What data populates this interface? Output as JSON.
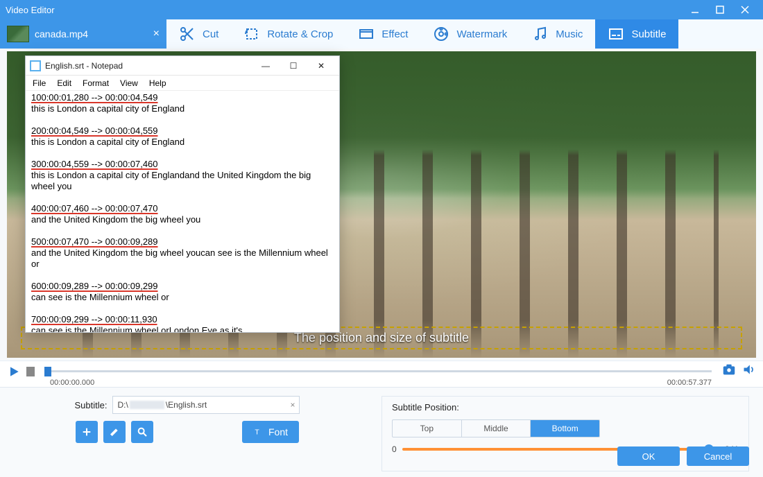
{
  "window": {
    "title": "Video Editor"
  },
  "file_tab": {
    "name": "canada.mp4"
  },
  "tabs": {
    "cut": "Cut",
    "rotate": "Rotate & Crop",
    "effect": "Effect",
    "watermark": "Watermark",
    "music": "Music",
    "subtitle": "Subtitle",
    "active": "subtitle"
  },
  "preview": {
    "overlay_text": "The position and size of subtitle"
  },
  "player": {
    "time_left": "00:00:00.000",
    "time_right": "00:00:57.377"
  },
  "subtitle_panel": {
    "label": "Subtitle:",
    "path_prefix": "D:\\",
    "path_suffix": "\\English.srt",
    "font_btn": "Font"
  },
  "position_panel": {
    "title": "Subtitle Position:",
    "options": {
      "top": "Top",
      "middle": "Middle",
      "bottom": "Bottom"
    },
    "active": "bottom",
    "slider_min": "0",
    "slider_max": "341"
  },
  "buttons": {
    "ok": "OK",
    "cancel": "Cancel"
  },
  "notepad": {
    "title": "English.srt - Notepad",
    "menu": {
      "file": "File",
      "edit": "Edit",
      "format": "Format",
      "view": "View",
      "help": "Help"
    },
    "entries": [
      {
        "ts": "100:00:01,280 --> 00:00:04,549",
        "text": "this is London a capital city of England"
      },
      {
        "ts": "200:00:04,549 --> 00:00:04,559",
        "text": "this is London a capital city of England"
      },
      {
        "ts": "300:00:04,559 --> 00:00:07,460",
        "text": "this is London a capital city of Englandand the United Kingdom the big wheel you"
      },
      {
        "ts": "400:00:07,460 --> 00:00:07,470",
        "text": "and the United Kingdom the big wheel you"
      },
      {
        "ts": "500:00:07,470 --> 00:00:09,289",
        "text": "and the United Kingdom the big wheel youcan see is the Millennium wheel or"
      },
      {
        "ts": "600:00:09,289 --> 00:00:09,299",
        "text": "can see is the Millennium wheel or"
      },
      {
        "ts": "700:00:09,299 --> 00:00:11,930",
        "text": "can see is the Millennium wheel orLondon Eye as it's"
      }
    ]
  }
}
